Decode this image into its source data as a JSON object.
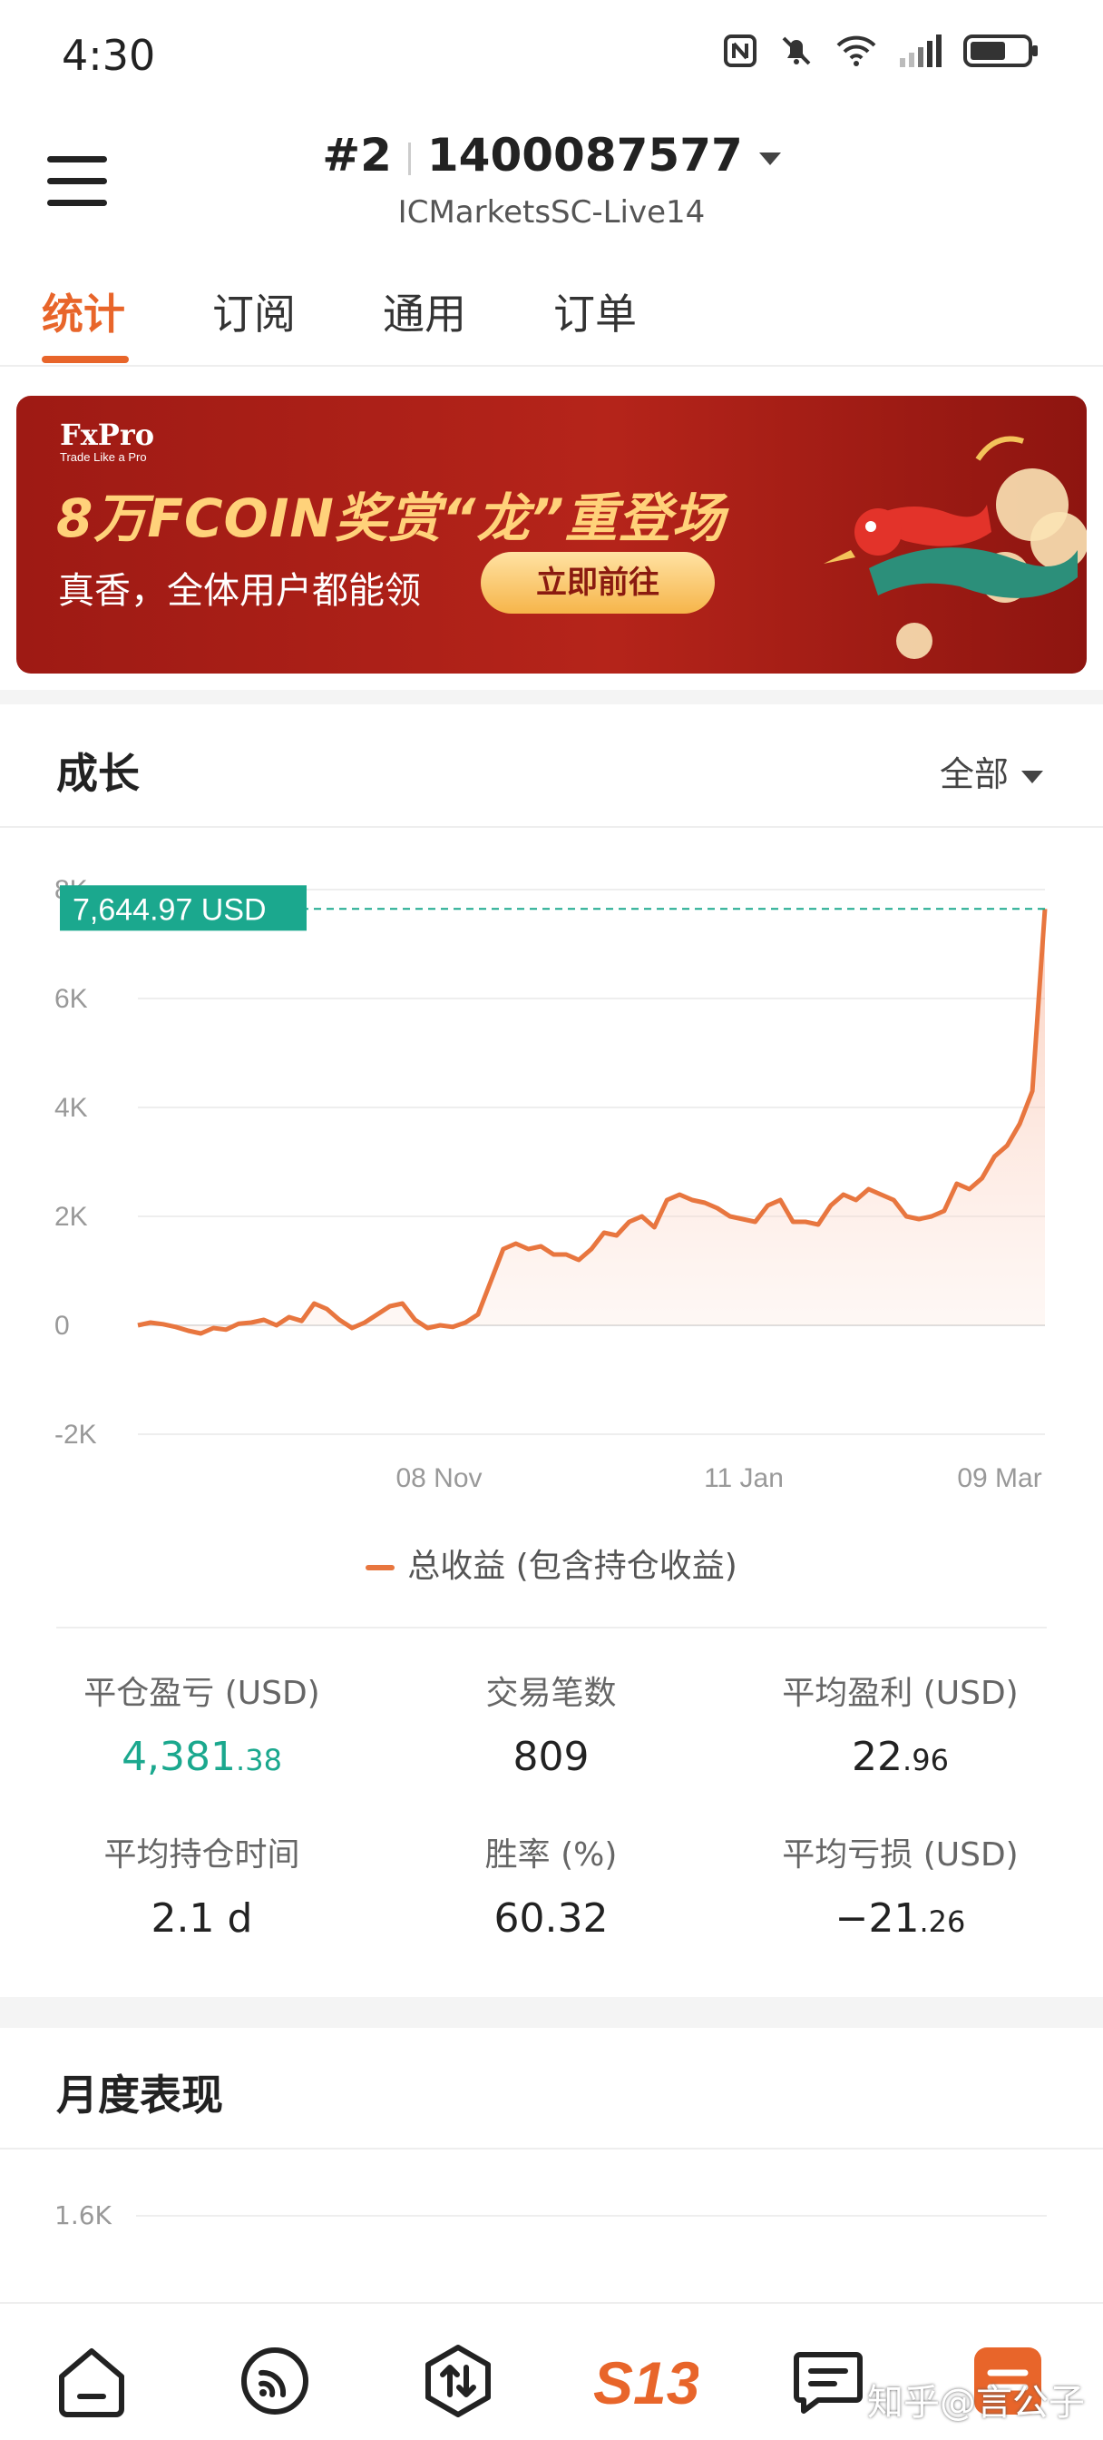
{
  "status_bar": {
    "time": "4:30",
    "icons": [
      "nfc-icon",
      "mute-icon",
      "wifi-icon",
      "signal-icon",
      "battery-icon"
    ]
  },
  "header": {
    "account": "#2",
    "account_number": "1400087577",
    "server": "ICMarketsSC-Live14"
  },
  "tabs": [
    {
      "label": "统计",
      "active": true
    },
    {
      "label": "订阅",
      "active": false
    },
    {
      "label": "通用",
      "active": false
    },
    {
      "label": "订单",
      "active": false
    }
  ],
  "banner": {
    "logo": "FxPro",
    "logo_tagline": "Trade Like a Pro",
    "title": "8万FCOIN奖赏“龙”重登场",
    "subtitle": "真香，全体用户都能领",
    "button": "立即前往"
  },
  "growth": {
    "title": "成长",
    "range": "全部",
    "current_label": "7,644.97 USD",
    "legend": "总收益 (包含持仓收益)"
  },
  "chart_data": {
    "type": "area",
    "title": "",
    "ylim": [
      -2000,
      8000
    ],
    "y_ticks": [
      "-2K",
      "0",
      "2K",
      "4K",
      "6K",
      "8K"
    ],
    "x_ticks": [
      "08 Nov",
      "11 Jan",
      "09 Mar"
    ],
    "series": [
      {
        "name": "总收益 (包含持仓收益)",
        "color": "#e8763f",
        "values": [
          0,
          50,
          20,
          -30,
          -100,
          -150,
          -50,
          -80,
          30,
          50,
          100,
          0,
          150,
          80,
          400,
          300,
          100,
          -50,
          50,
          200,
          350,
          400,
          100,
          -50,
          0,
          -30,
          50,
          200,
          800,
          1400,
          1500,
          1400,
          1450,
          1300,
          1300,
          1200,
          1400,
          1700,
          1650,
          1900,
          2000,
          1800,
          2300,
          2400,
          2300,
          2250,
          2150,
          2000,
          1950,
          1900,
          2200,
          2300,
          1900,
          1900,
          1850,
          2200,
          2400,
          2300,
          2500,
          2400,
          2300,
          2000,
          1950,
          2000,
          2100,
          2600,
          2500,
          2700,
          3100,
          3300,
          3700,
          4300,
          7644.97
        ]
      }
    ]
  },
  "stats": [
    {
      "label": "平仓盈亏 (USD)",
      "int": "4,381",
      "dec": ".38",
      "green": true
    },
    {
      "label": "交易笔数",
      "int": "809",
      "dec": "",
      "green": false
    },
    {
      "label": "平均盈利 (USD)",
      "int": "22",
      "dec": ".96",
      "green": false
    },
    {
      "label": "平均持仓时间",
      "int": "2.1 d",
      "dec": "",
      "green": false
    },
    {
      "label": "胜率 (%)",
      "int": "60.32",
      "dec": "",
      "green": false
    },
    {
      "label": "平均亏损 (USD)",
      "int": "−21",
      "dec": ".26",
      "green": false
    }
  ],
  "monthly": {
    "title": "月度表现",
    "top_tick": "1.6K"
  },
  "bottom_nav": [
    "home-icon",
    "signal-feed-icon",
    "trade-icon",
    "s13-icon",
    "messages-icon",
    "profile-icon"
  ],
  "watermark": "知乎@言公子"
}
